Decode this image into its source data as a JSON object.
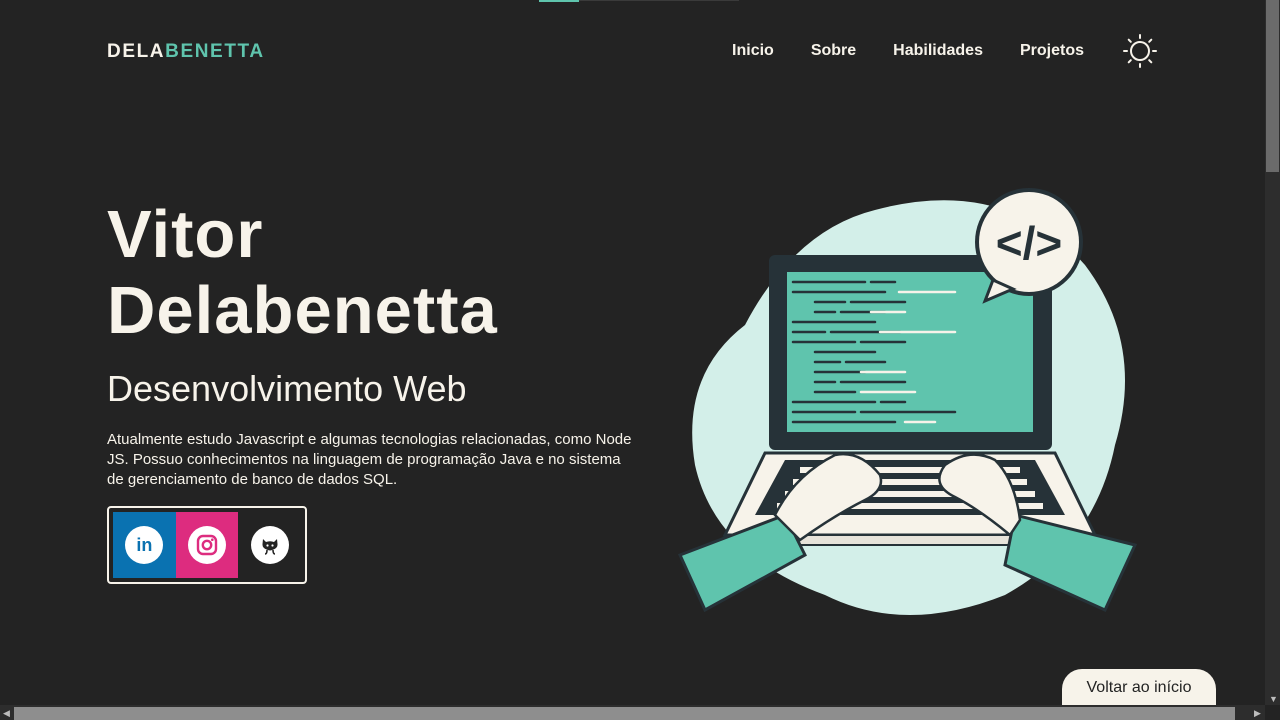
{
  "header": {
    "logo_part1": "DELA",
    "logo_part2": "BENETTA",
    "nav": [
      "Inicio",
      "Sobre",
      "Habilidades",
      "Projetos"
    ],
    "theme_icon": "sun-icon"
  },
  "hero": {
    "name_line1": "Vitor",
    "name_line2": "Delabenetta",
    "subtitle": "Desenvolvimento Web",
    "description": "Atualmente estudo Javascript e algumas tecnologias relacionadas, como Node JS. Possuo conhecimentos na linguagem de programação Java e no sistema de gerenciamento de banco de dados SQL.",
    "socials": [
      {
        "name": "linkedin-icon",
        "label": "in"
      },
      {
        "name": "instagram-icon"
      },
      {
        "name": "github-icon"
      }
    ]
  },
  "illustration": {
    "code_tag": "</>"
  },
  "back_to_top": "Voltar ao início",
  "colors": {
    "background": "#232323",
    "accent": "#5fc4ad",
    "text": "#f7f3ea",
    "linkedin": "#0a72b1",
    "instagram": "#dd2c7f"
  }
}
